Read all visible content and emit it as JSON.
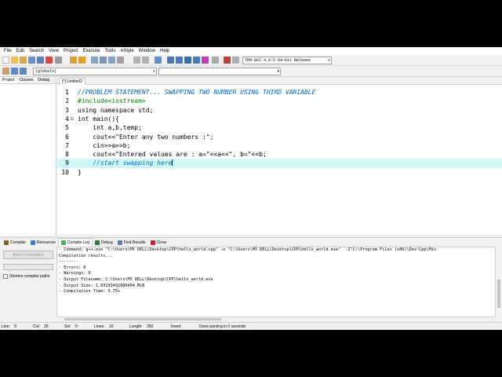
{
  "menu": [
    "File",
    "Edit",
    "Search",
    "View",
    "Project",
    "Execute",
    "Tools",
    "AStyle",
    "Window",
    "Help"
  ],
  "toolbar": {
    "compiler": "TDM-GCC 4.9.2 64-bit Release",
    "scope": "(globals)"
  },
  "left_tabs": [
    "Project",
    "Classes",
    "Debug"
  ],
  "editor": {
    "tab_label": "[*] Untitled2",
    "lines": [
      {
        "n": "1",
        "fold": "",
        "text": "//PROBLEM STATEMENT... SWAPPING TWO NUMBER USING THIRD VARIABLE",
        "style": "comment"
      },
      {
        "n": "2",
        "fold": "",
        "text": "#include<iostream>",
        "style": "pre"
      },
      {
        "n": "3",
        "fold": "",
        "text": "using namespace std;",
        "style": "plain"
      },
      {
        "n": "4",
        "fold": "⊟",
        "text": "int main(){",
        "style": "plain"
      },
      {
        "n": "5",
        "fold": "",
        "text": "    int a,b,temp;",
        "style": "plain"
      },
      {
        "n": "6",
        "fold": "",
        "text": "    cout<<\"Enter any two numbers :\";",
        "style": "plain"
      },
      {
        "n": "7",
        "fold": "",
        "text": "    cin>>a>>b;",
        "style": "plain"
      },
      {
        "n": "8",
        "fold": "",
        "text": "    cout<<\"Entered values are : a=\"<<a<<\", b=\"<<b;",
        "style": "plain"
      },
      {
        "n": "9",
        "fold": "",
        "text": "    //start swapping here",
        "style": "comment"
      },
      {
        "n": "10",
        "fold": "",
        "text": "}",
        "style": "plain"
      }
    ],
    "current_line": "9"
  },
  "bottom_tabs": [
    {
      "label": "Compiler",
      "icon": "compiler-icon",
      "color": "#8a5a2a"
    },
    {
      "label": "Resources",
      "icon": "resources-icon",
      "color": "#3a7bd5"
    },
    {
      "label": "Compile Log",
      "icon": "compile-log-icon",
      "color": "#4caf50"
    },
    {
      "label": "Debug",
      "icon": "debug-icon",
      "color": "#2e7d32"
    },
    {
      "label": "Find Results",
      "icon": "find-results-icon",
      "color": "#5d7fb5"
    },
    {
      "label": "Close",
      "icon": "close-icon",
      "color": "#c62828"
    }
  ],
  "active_bottom_tab": "Compile Log",
  "abort_label": "Abort Compilation",
  "shorten_label": "Shorten compiler paths",
  "log_lines": [
    "- Command: g++.exe \"C:\\Users\\MY DELL\\Desktop\\CPP\\hello_world.cpp\" -o \"C:\\Users\\MY DELL\\Desktop\\CPP\\hello_world.exe\"  -I\"C:\\Program Files (x86)\\Dev-Cpp\\Min",
    "",
    "Compilation results...",
    "--------",
    "- Errors: 0",
    "- Warnings: 0",
    "- Output Filename: C:\\Users\\MY DELL\\Desktop\\CPP\\hello_world.exe",
    "- Output Size: 1.83193492889404 MiB",
    "- Compilation Time: 3.75s"
  ],
  "status": {
    "line_label": "Line:",
    "line_value": "9",
    "col_label": "Col:",
    "col_value": "26",
    "sel_label": "Sel:",
    "sel_value": "0",
    "lines_label": "Lines:",
    "lines_value": "10",
    "length_label": "Length:",
    "length_value": "260",
    "mode": "Insert",
    "message": "Done parsing in 0 seconds"
  }
}
